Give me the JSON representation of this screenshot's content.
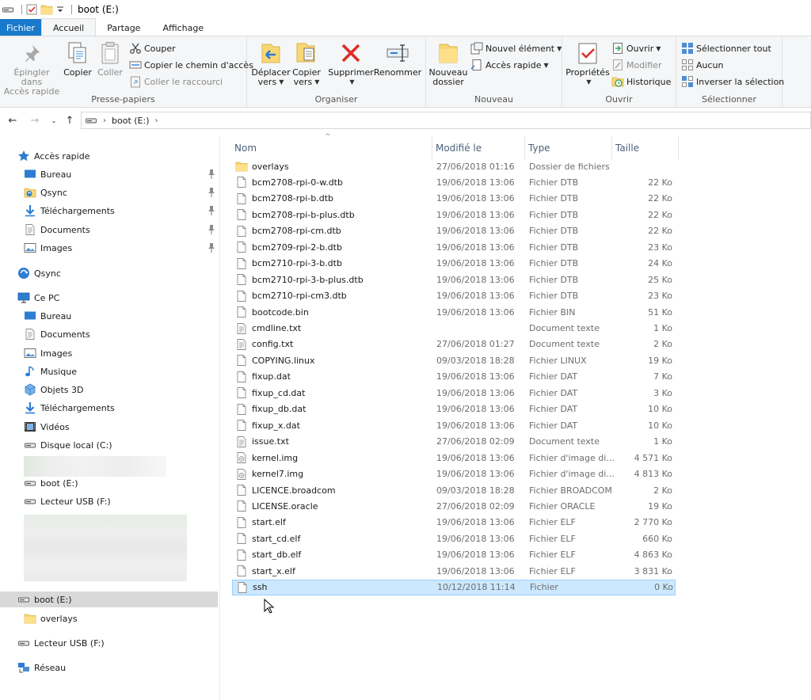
{
  "window": {
    "title": "boot (E:)"
  },
  "tabs": [
    {
      "label": "Fichier"
    },
    {
      "label": "Accueil"
    },
    {
      "label": "Partage"
    },
    {
      "label": "Affichage"
    }
  ],
  "ribbon": {
    "clipboard": {
      "label": "Presse-papiers",
      "pin_line1": "Épingler dans",
      "pin_line2": "Accès rapide",
      "copy": "Copier",
      "paste": "Coller",
      "cut": "Couper",
      "copy_path": "Copier le chemin d'accès",
      "paste_shortcut": "Coller le raccourci"
    },
    "organize": {
      "label": "Organiser",
      "move_line1": "Déplacer",
      "move_line2": "vers",
      "copyto_line1": "Copier",
      "copyto_line2": "vers",
      "delete": "Supprimer",
      "rename": "Renommer"
    },
    "new": {
      "label": "Nouveau",
      "folder_line1": "Nouveau",
      "folder_line2": "dossier",
      "new_item": "Nouvel élément",
      "easy_access": "Accès rapide"
    },
    "open": {
      "label": "Ouvrir",
      "properties": "Propriétés",
      "open": "Ouvrir",
      "edit": "Modifier",
      "history": "Historique"
    },
    "select": {
      "label": "Sélectionner",
      "select_all": "Sélectionner tout",
      "select_none": "Aucun",
      "invert": "Inverser la sélection"
    }
  },
  "address": {
    "crumb": "boot (E:)"
  },
  "nav": {
    "quick_access": "Accès rapide",
    "quick_items": [
      "Bureau",
      "Qsync",
      "Téléchargements",
      "Documents",
      "Images"
    ],
    "qsync": "Qsync",
    "this_pc": "Ce PC",
    "pc_items": [
      "Bureau",
      "Documents",
      "Images",
      "Musique",
      "Objets 3D",
      "Téléchargements",
      "Vidéos",
      "Disque local (C:)"
    ],
    "boot1": "boot (E:)",
    "usb1": "Lecteur USB (F:)",
    "boot2": "boot (E:)",
    "overlays": "overlays",
    "usb2": "Lecteur USB (F:)",
    "network": "Réseau"
  },
  "columns": {
    "name": "Nom",
    "modified": "Modifié le",
    "type": "Type",
    "size": "Taille"
  },
  "files": [
    {
      "name": "overlays",
      "date": "27/06/2018 01:16",
      "type": "Dossier de fichiers",
      "size": "",
      "icon": "folder"
    },
    {
      "name": "bcm2708-rpi-0-w.dtb",
      "date": "19/06/2018 13:06",
      "type": "Fichier DTB",
      "size": "22 Ko",
      "icon": "file"
    },
    {
      "name": "bcm2708-rpi-b.dtb",
      "date": "19/06/2018 13:06",
      "type": "Fichier DTB",
      "size": "22 Ko",
      "icon": "file"
    },
    {
      "name": "bcm2708-rpi-b-plus.dtb",
      "date": "19/06/2018 13:06",
      "type": "Fichier DTB",
      "size": "22 Ko",
      "icon": "file"
    },
    {
      "name": "bcm2708-rpi-cm.dtb",
      "date": "19/06/2018 13:06",
      "type": "Fichier DTB",
      "size": "22 Ko",
      "icon": "file"
    },
    {
      "name": "bcm2709-rpi-2-b.dtb",
      "date": "19/06/2018 13:06",
      "type": "Fichier DTB",
      "size": "23 Ko",
      "icon": "file"
    },
    {
      "name": "bcm2710-rpi-3-b.dtb",
      "date": "19/06/2018 13:06",
      "type": "Fichier DTB",
      "size": "24 Ko",
      "icon": "file"
    },
    {
      "name": "bcm2710-rpi-3-b-plus.dtb",
      "date": "19/06/2018 13:06",
      "type": "Fichier DTB",
      "size": "25 Ko",
      "icon": "file"
    },
    {
      "name": "bcm2710-rpi-cm3.dtb",
      "date": "19/06/2018 13:06",
      "type": "Fichier DTB",
      "size": "23 Ko",
      "icon": "file"
    },
    {
      "name": "bootcode.bin",
      "date": "19/06/2018 13:06",
      "type": "Fichier BIN",
      "size": "51 Ko",
      "icon": "file"
    },
    {
      "name": "cmdline.txt",
      "date": "",
      "type": "Document texte",
      "size": "1 Ko",
      "icon": "text"
    },
    {
      "name": "config.txt",
      "date": "27/06/2018 01:27",
      "type": "Document texte",
      "size": "2 Ko",
      "icon": "text"
    },
    {
      "name": "COPYING.linux",
      "date": "09/03/2018 18:28",
      "type": "Fichier LINUX",
      "size": "19 Ko",
      "icon": "file"
    },
    {
      "name": "fixup.dat",
      "date": "19/06/2018 13:06",
      "type": "Fichier DAT",
      "size": "7 Ko",
      "icon": "file"
    },
    {
      "name": "fixup_cd.dat",
      "date": "19/06/2018 13:06",
      "type": "Fichier DAT",
      "size": "3 Ko",
      "icon": "file"
    },
    {
      "name": "fixup_db.dat",
      "date": "19/06/2018 13:06",
      "type": "Fichier DAT",
      "size": "10 Ko",
      "icon": "file"
    },
    {
      "name": "fixup_x.dat",
      "date": "19/06/2018 13:06",
      "type": "Fichier DAT",
      "size": "10 Ko",
      "icon": "file"
    },
    {
      "name": "issue.txt",
      "date": "27/06/2018 02:09",
      "type": "Document texte",
      "size": "1 Ko",
      "icon": "text"
    },
    {
      "name": "kernel.img",
      "date": "19/06/2018 13:06",
      "type": "Fichier d'image di...",
      "size": "4 571 Ko",
      "icon": "disk"
    },
    {
      "name": "kernel7.img",
      "date": "19/06/2018 13:06",
      "type": "Fichier d'image di...",
      "size": "4 813 Ko",
      "icon": "disk"
    },
    {
      "name": "LICENCE.broadcom",
      "date": "09/03/2018 18:28",
      "type": "Fichier BROADCOM",
      "size": "2 Ko",
      "icon": "file"
    },
    {
      "name": "LICENSE.oracle",
      "date": "27/06/2018 02:09",
      "type": "Fichier ORACLE",
      "size": "19 Ko",
      "icon": "file"
    },
    {
      "name": "start.elf",
      "date": "19/06/2018 13:06",
      "type": "Fichier ELF",
      "size": "2 770 Ko",
      "icon": "file"
    },
    {
      "name": "start_cd.elf",
      "date": "19/06/2018 13:06",
      "type": "Fichier ELF",
      "size": "660 Ko",
      "icon": "file"
    },
    {
      "name": "start_db.elf",
      "date": "19/06/2018 13:06",
      "type": "Fichier ELF",
      "size": "4 863 Ko",
      "icon": "file"
    },
    {
      "name": "start_x.elf",
      "date": "19/06/2018 13:06",
      "type": "Fichier ELF",
      "size": "3 831 Ko",
      "icon": "file"
    },
    {
      "name": "ssh",
      "date": "10/12/2018 11:14",
      "type": "Fichier",
      "size": "0 Ko",
      "icon": "file",
      "selected": true
    }
  ],
  "colors": {
    "file_tab": "#1979ca",
    "selection": "#cce8ff",
    "selection_border": "#99d1ff",
    "folder": "#f8d775",
    "header_text": "#4c607a"
  }
}
